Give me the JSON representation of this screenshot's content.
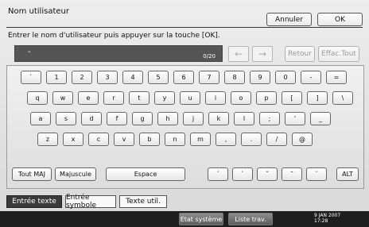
{
  "title": "Nom utilisateur",
  "buttons": {
    "cancel": "Annuler",
    "ok": "OK"
  },
  "instruction": "Entrer le nom d'utilisateur puis appuyer sur la touche [OK].",
  "entry": {
    "value": "-",
    "count": "0/20"
  },
  "nav": {
    "left_icon": "arrow-left-icon",
    "right_icon": "arrow-right-icon",
    "retour": "Retour",
    "effac_tout": "Effac.Tout"
  },
  "keyboard": {
    "row1": [
      "`",
      "1",
      "2",
      "3",
      "4",
      "5",
      "6",
      "7",
      "8",
      "9",
      "0",
      "-",
      "="
    ],
    "row2": [
      "q",
      "w",
      "e",
      "r",
      "t",
      "y",
      "u",
      "i",
      "o",
      "p",
      "[",
      "]",
      "\\"
    ],
    "row3": [
      "a",
      "s",
      "d",
      "f",
      "g",
      "h",
      "j",
      "k",
      "l",
      ";",
      "'",
      "_"
    ],
    "row4": [
      "z",
      "x",
      "c",
      "v",
      "b",
      "n",
      "m",
      ",",
      ".",
      "/",
      "@"
    ],
    "bottom": {
      "tout_maj": "Tout MAJ",
      "majuscule": "Majuscule",
      "espace": "Espace",
      "accents": [
        "´",
        "`",
        "ˆ",
        "˜",
        "¨"
      ],
      "alt": "ALT"
    }
  },
  "tabs": [
    "Entrée texte",
    "Entrée symbole",
    "Texte util."
  ],
  "status": {
    "etat_systeme": "Etat système",
    "liste_trav": "Liste trav.",
    "date": "9 JAN 2007",
    "time": "17:28"
  }
}
